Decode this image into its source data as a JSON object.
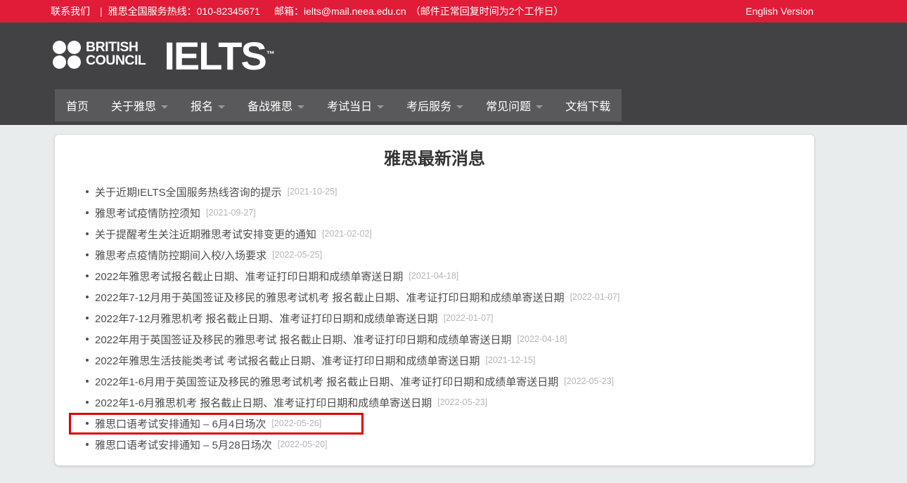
{
  "colors": {
    "topbar_red": "#e11c38",
    "header_gray": "#424245",
    "nav_gray": "#59595b",
    "highlight_red": "#dc0000",
    "page_bg": "#e9eced"
  },
  "topbar": {
    "contact": "联系我们",
    "divider": "|",
    "hotline": "雅思全国服务热线：010-82345671",
    "email": "邮箱：ielts@mail.neea.edu.cn",
    "note": "（邮件正常回复时间为2个工作日）",
    "english_version": "English Version"
  },
  "header": {
    "logo": {
      "council_line1": "BRITISH",
      "council_line2": "COUNCIL",
      "brand": "IELTS",
      "tm": "™"
    },
    "nav": [
      {
        "label": "首页"
      },
      {
        "label": "关于雅思"
      },
      {
        "label": "报名"
      },
      {
        "label": "备战雅思"
      },
      {
        "label": "考试当日"
      },
      {
        "label": "考后服务"
      },
      {
        "label": "常见问题"
      },
      {
        "label": "文档下载"
      }
    ]
  },
  "main": {
    "title": "雅思最新消息",
    "news": [
      {
        "title": "关于近期IELTS全国服务热线咨询的提示",
        "date": "[2021-10-25]"
      },
      {
        "title": "雅思考试疫情防控须知",
        "date": "[2021-09-27]"
      },
      {
        "title": "关于提醒考生关注近期雅思考试安排变更的通知",
        "date": "[2021-02-02]"
      },
      {
        "title": "雅思考点疫情防控期间入校/入场要求",
        "date": "[2022-05-25]"
      },
      {
        "title": "2022年雅思考试报名截止日期、准考证打印日期和成绩单寄送日期",
        "date": "[2021-04-18]"
      },
      {
        "title": "2022年7-12月用于英国签证及移民的雅思考试机考 报名截止日期、准考证打印日期和成绩单寄送日期",
        "date": "[2022-01-07]"
      },
      {
        "title": "2022年7-12月雅思机考 报名截止日期、准考证打印日期和成绩单寄送日期",
        "date": "[2022-01-07]"
      },
      {
        "title": "2022年用于英国签证及移民的雅思考试 报名截止日期、准考证打印日期和成绩单寄送日期",
        "date": "[2022-04-18]"
      },
      {
        "title": "2022年雅思生活技能类考试 考试报名截止日期、准考证打印日期和成绩单寄送日期",
        "date": "[2021-12-15]"
      },
      {
        "title": "2022年1-6月用于英国签证及移民的雅思考试机考 报名截止日期、准考证打印日期和成绩单寄送日期",
        "date": "[2022-05-23]"
      },
      {
        "title": "2022年1-6月雅思机考 报名截止日期、准考证打印日期和成绩单寄送日期",
        "date": "[2022-05-23]"
      },
      {
        "title": "雅思口语考试安排通知 – 6月4日场次",
        "date": "[2022-05-26]",
        "highlighted": true
      },
      {
        "title": "雅思口语考试安排通知 – 5月28日场次",
        "date": "[2022-05-20]"
      }
    ]
  }
}
